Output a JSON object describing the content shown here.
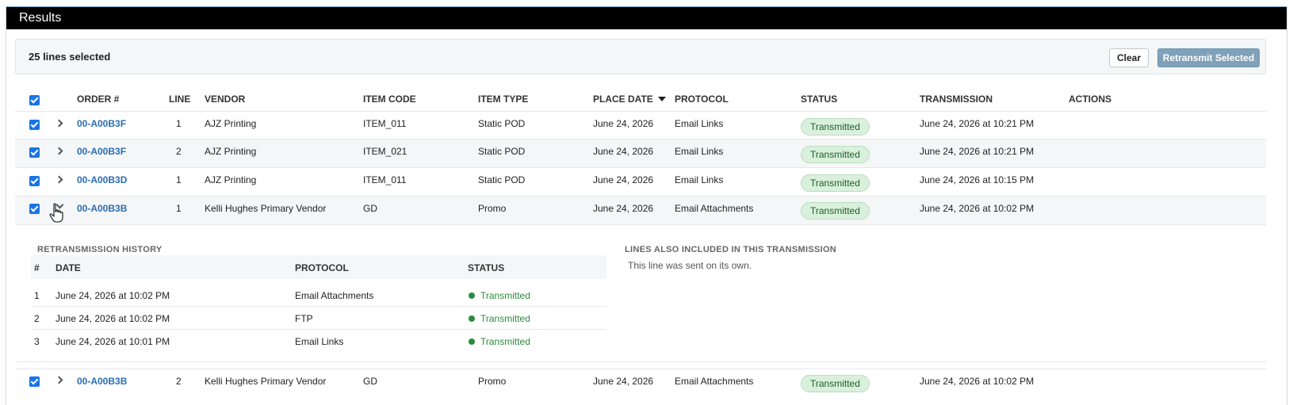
{
  "header": {
    "title": "Results"
  },
  "selection": {
    "count_label": "25 lines selected",
    "clear_label": "Clear",
    "retransmit_label": "Retransmit Selected"
  },
  "columns": {
    "order": "ORDER #",
    "line": "LINE",
    "vendor": "VENDOR",
    "item_code": "ITEM CODE",
    "item_type": "ITEM TYPE",
    "place_date": "PLACE DATE",
    "protocol": "PROTOCOL",
    "status": "STATUS",
    "transmission": "TRANSMISSION",
    "actions": "ACTIONS"
  },
  "sort": {
    "column": "place_date",
    "direction": "descending"
  },
  "rows": [
    {
      "order": "00-A00B3F",
      "line": "1",
      "vendor": "AJZ Printing",
      "item_code": "ITEM_011",
      "item_type": "Static POD",
      "place_date": "June 24, 2026",
      "protocol": "Email Links",
      "status": "Transmitted",
      "transmission": "June 24, 2026 at 10:21 PM",
      "selected": true,
      "expanded": false
    },
    {
      "order": "00-A00B3F",
      "line": "2",
      "vendor": "AJZ Printing",
      "item_code": "ITEM_021",
      "item_type": "Static POD",
      "place_date": "June 24, 2026",
      "protocol": "Email Links",
      "status": "Transmitted",
      "transmission": "June 24, 2026 at 10:21 PM",
      "selected": true,
      "expanded": false
    },
    {
      "order": "00-A00B3D",
      "line": "1",
      "vendor": "AJZ Printing",
      "item_code": "ITEM_011",
      "item_type": "Static POD",
      "place_date": "June 24, 2026",
      "protocol": "Email Links",
      "status": "Transmitted",
      "transmission": "June 24, 2026 at 10:15 PM",
      "selected": true,
      "expanded": false
    },
    {
      "order": "00-A00B3B",
      "line": "1",
      "vendor": "Kelli Hughes Primary Vendor",
      "item_code": "GD",
      "item_type": "Promo",
      "place_date": "June 24, 2026",
      "protocol": "Email Attachments",
      "status": "Transmitted",
      "transmission": "June 24, 2026 at 10:02 PM",
      "selected": true,
      "expanded": true
    },
    {
      "order": "00-A00B3B",
      "line": "2",
      "vendor": "Kelli Hughes Primary Vendor",
      "item_code": "GD",
      "item_type": "Promo",
      "place_date": "June 24, 2026",
      "protocol": "Email Attachments",
      "status": "Transmitted",
      "transmission": "June 24, 2026 at 10:02 PM",
      "selected": true,
      "expanded": false
    }
  ],
  "detail": {
    "history_title": "RETRANSMISSION HISTORY",
    "history_columns": {
      "num": "#",
      "date": "DATE",
      "protocol": "PROTOCOL",
      "status": "STATUS"
    },
    "history": [
      {
        "num": "1",
        "date": "June 24, 2026 at 10:02 PM",
        "protocol": "Email Attachments",
        "status": "Transmitted"
      },
      {
        "num": "2",
        "date": "June 24, 2026 at 10:02 PM",
        "protocol": "FTP",
        "status": "Transmitted"
      },
      {
        "num": "3",
        "date": "June 24, 2026 at 10:01 PM",
        "protocol": "Email Links",
        "status": "Transmitted"
      }
    ],
    "also_title": "LINES ALSO INCLUDED IN THIS TRANSMISSION",
    "also_text": "This line was sent on its own."
  },
  "colors": {
    "header_bg": "#000000",
    "link": "#2a6db0",
    "checkbox": "#1a73e8",
    "badge_bg": "#d9f0dc",
    "badge_text": "#1e5e2a",
    "status_dot": "#2e8b3e",
    "retransmit_bg": "#7fa1b9"
  }
}
